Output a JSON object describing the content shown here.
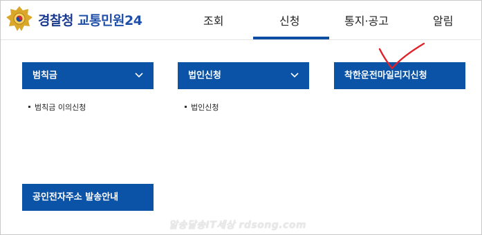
{
  "brand": {
    "part1": "경찰청",
    "part2": "교통민원24"
  },
  "nav": {
    "items": [
      "조회",
      "신청",
      "통지·공고",
      "알림"
    ],
    "active": "신청"
  },
  "menus": [
    {
      "label": "범칙금",
      "has_chevron": true,
      "sub_items": [
        "범칙금 이의신청"
      ]
    },
    {
      "label": "법인신청",
      "has_chevron": true,
      "sub_items": [
        "법인신청"
      ]
    },
    {
      "label": "착한운전마일리지신청",
      "has_chevron": false,
      "sub_items": []
    },
    {
      "label": "공인전자주소 발송안내",
      "has_chevron": false,
      "sub_items": []
    }
  ],
  "watermark": "알송달송IT세상 rdsong.com",
  "colors": {
    "menu_bg": "#0b53a7",
    "nav_active": "#0b4ea2",
    "brand": "#1a3a8f",
    "annotation": "#e0202a"
  },
  "icons": {
    "logo": "police-emblem-icon",
    "chevron": "chevron-down-icon",
    "annotation": "checkmark-annotation-icon"
  }
}
